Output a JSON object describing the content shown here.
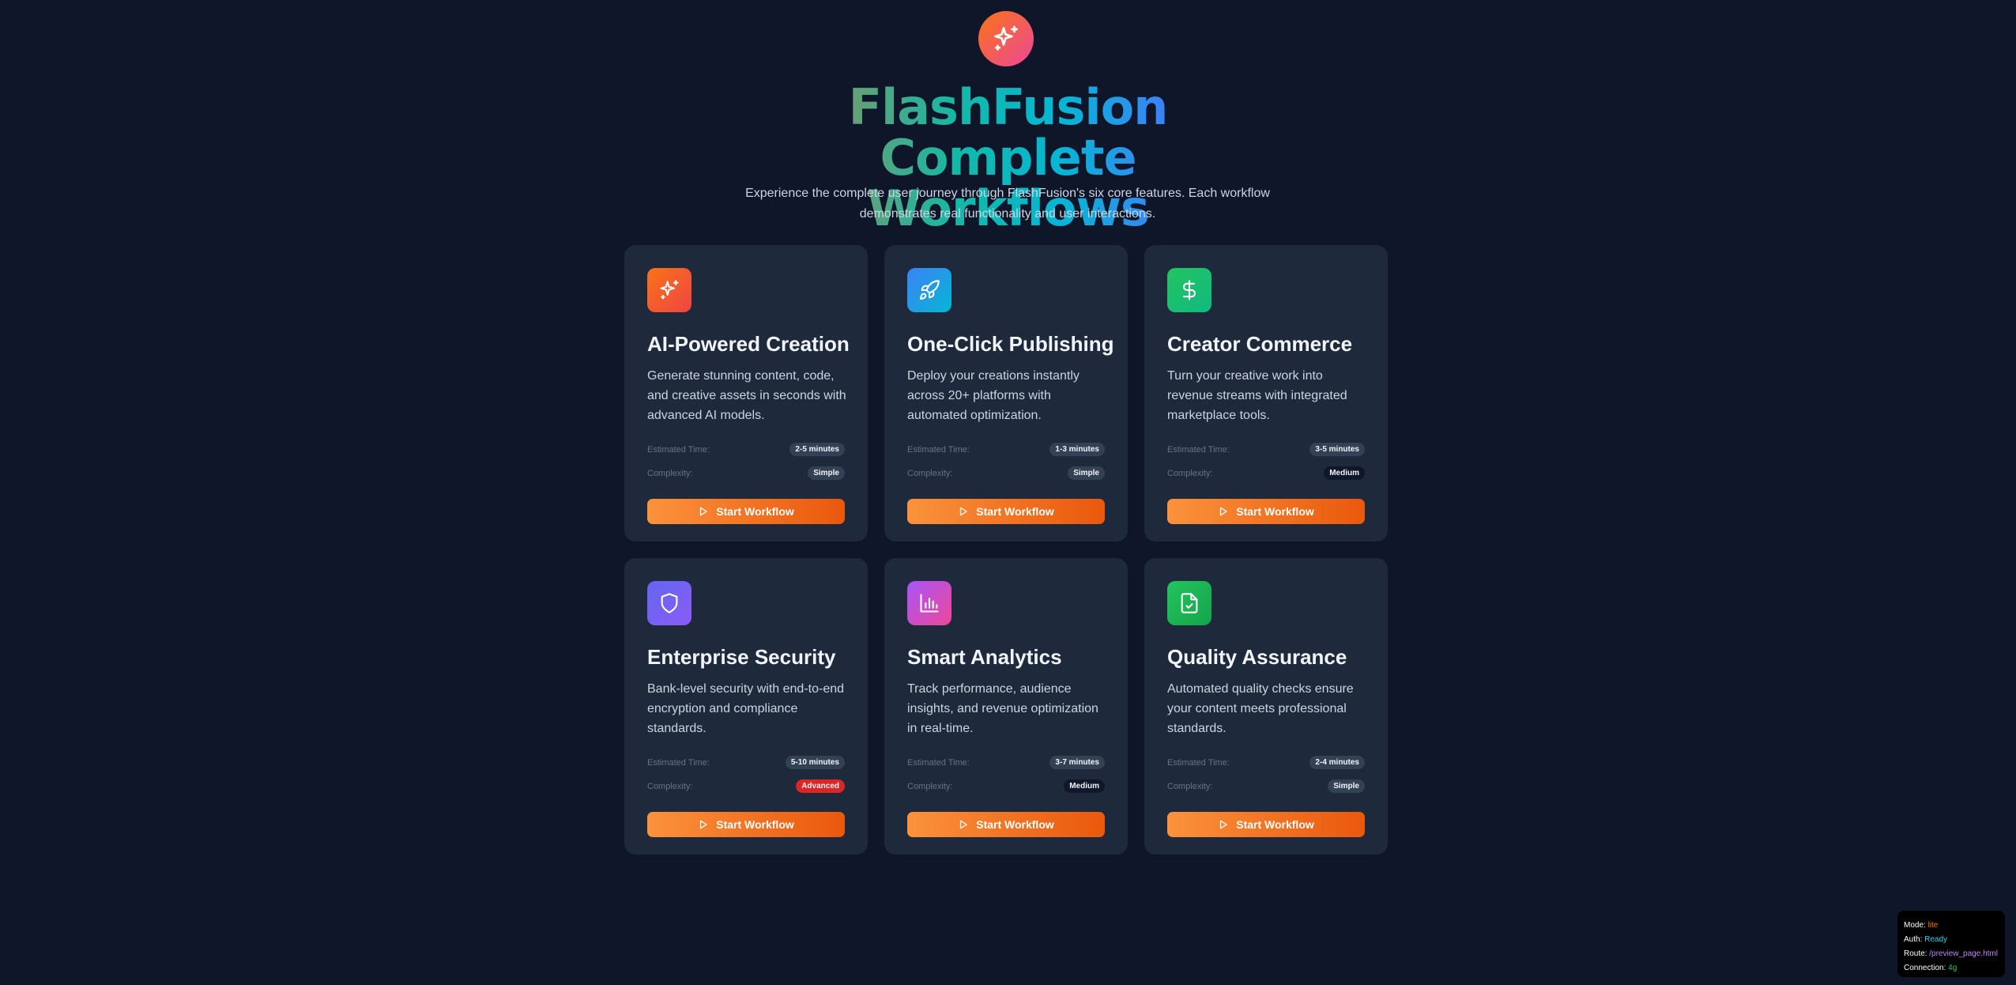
{
  "header": {
    "title": "FlashFusion Complete Workflows",
    "subtitle": "Experience the complete user journey through FlashFusion's six core features. Each workflow demonstrates real functionality and user interactions.",
    "icon": "sparkles-icon",
    "gradient": [
      "#f97316",
      "#ec4899"
    ]
  },
  "labels": {
    "estimated_time": "Estimated Time:",
    "complexity": "Complexity:"
  },
  "cards": [
    {
      "title": "AI-Powered Creation",
      "description": "Generate stunning content, code, and creative assets in seconds with advanced AI models.",
      "time": "2-5 minutes",
      "complexity": "Simple",
      "button": "Start Workflow",
      "icon": "sparkles-icon",
      "gradient": [
        "#f97316",
        "#ef4444"
      ]
    },
    {
      "title": "One-Click Publishing",
      "description": "Deploy your creations instantly across 20+ platforms with automated optimization.",
      "time": "1-3 minutes",
      "complexity": "Simple",
      "button": "Start Workflow",
      "icon": "rocket-icon",
      "gradient": [
        "#3b82f6",
        "#06b6d4"
      ]
    },
    {
      "title": "Creator Commerce",
      "description": "Turn your creative work into revenue streams with integrated marketplace tools.",
      "time": "3-5 minutes",
      "complexity": "Medium",
      "button": "Start Workflow",
      "icon": "dollar-icon",
      "gradient": [
        "#22c55e",
        "#10b981"
      ]
    },
    {
      "title": "Enterprise Security",
      "description": "Bank-level security with end-to-end encryption and compliance standards.",
      "time": "5-10 minutes",
      "complexity": "Advanced",
      "button": "Start Workflow",
      "icon": "shield-icon",
      "gradient": [
        "#6366f1",
        "#8b5cf6"
      ]
    },
    {
      "title": "Smart Analytics",
      "description": "Track performance, audience insights, and revenue optimization in real-time.",
      "time": "3-7 minutes",
      "complexity": "Medium",
      "button": "Start Workflow",
      "icon": "bar-chart-icon",
      "gradient": [
        "#a855f7",
        "#ec4899"
      ]
    },
    {
      "title": "Quality Assurance",
      "description": "Automated quality checks ensure your content meets professional standards.",
      "time": "2-4 minutes",
      "complexity": "Simple",
      "button": "Start Workflow",
      "icon": "file-check-icon",
      "gradient": [
        "#22c55e",
        "#16a34a"
      ]
    }
  ],
  "debug": {
    "mode_label": "Mode:",
    "mode": "lite",
    "auth_label": "Auth:",
    "auth": "Ready",
    "route_label": "Route:",
    "route": "/preview_page.html",
    "connection_label": "Connection:",
    "connection": "4g"
  },
  "colors": {
    "background": "#0f1629",
    "card": "#1e293b",
    "button_start": "#fb923c",
    "button_end": "#ea580c",
    "advanced": "#dc2626"
  }
}
